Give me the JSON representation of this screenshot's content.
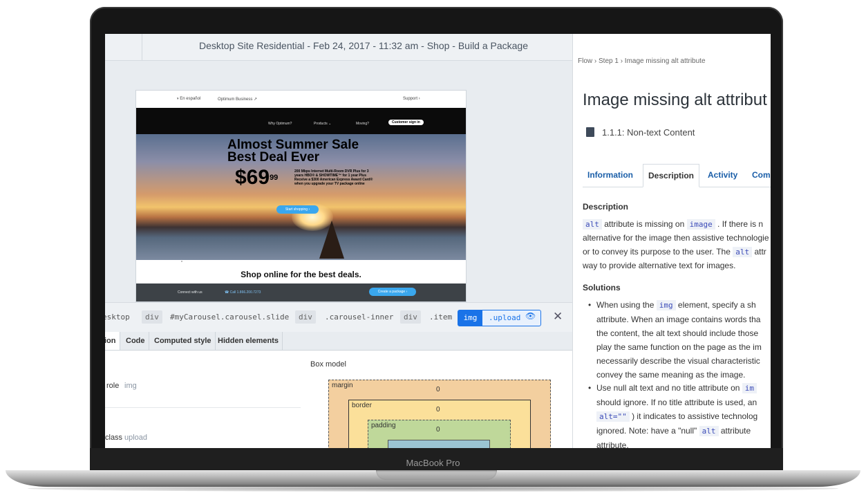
{
  "device": {
    "label": "MacBook Pro"
  },
  "header": {
    "title": "Desktop Site Residential - Feb 24, 2017 - 11:32 am - Shop - Build a Package"
  },
  "site": {
    "util_lang": "◑ En español",
    "util_business": "Optimum Business ↗",
    "util_support": "Support  ›",
    "nav_why": "Why Optimum?",
    "nav_products": "Products  ⌄",
    "nav_moving": "Moving?",
    "nav_signin": "Customer sign in",
    "hero_line1": "Almost Summer Sale",
    "hero_line2": "Best Deal Ever",
    "hero_price": "$69",
    "hero_price_cents": "99",
    "hero_promo": "200 Mbps Internet Multi-Room DVR Plus for 3 years HBO® & SHOWTIME™ for 1 year Plus Receive a $300 American Express Award Card® when you upgrade your TV package online",
    "hero_button": "Start shopping  ›",
    "shop_heading": "Shop online for the best deals.",
    "footer_connect": "Connect with us",
    "footer_call": "☎  Call 1.866.200.7273",
    "footer_cta": "Create a package  ›"
  },
  "crumbs": {
    "desktop": "esktop",
    "div1": "div",
    "carousel": "#myCarousel.carousel.slide",
    "div2": "div",
    "inner": ".carousel-inner",
    "div3": "div",
    "item": ".item",
    "selected_tag": "img",
    "selected_class": ".upload",
    "eye": "👁",
    "close": "✕"
  },
  "tabs": {
    "t1": "ion",
    "t2": "Code",
    "t3": "Computed style",
    "t4": "Hidden elements"
  },
  "props": {
    "role_label": "role",
    "role_value": "img",
    "class_label": "class",
    "class_value": "upload"
  },
  "box_model": {
    "title": "Box model",
    "margin_label": "margin",
    "margin_value": "0",
    "border_label": "border",
    "border_value": "0",
    "padding_label": "padding",
    "padding_value": "0"
  },
  "issue": {
    "breadcrumb": "Flow  ›  Step 1  ›  Image missing alt attribute",
    "title": "Image missing alt attribut",
    "criterion": "1.1.1: Non-text Content",
    "tabs": [
      "Information",
      "Description",
      "Activity",
      "Comm"
    ],
    "desc_heading": "Description",
    "desc_p1_code1": "alt",
    "desc_p1_text1": " attribute is missing on ",
    "desc_p1_code2": "image",
    "desc_p1_text2": " . If there is n",
    "desc_p2": "alternative for the image then assistive technologie",
    "desc_p3_text1": "or to convey its purpose to the user. The ",
    "desc_p3_code": "alt",
    "desc_p3_text2": " attr",
    "desc_p4": "way to provide alternative text for images.",
    "sol_heading": "Solutions",
    "b1_l1_text1": "When using the ",
    "b1_l1_code": "img",
    "b1_l1_text2": " element, specify a sh",
    "b1_l2": "attribute. When an image contains words tha",
    "b1_l3": "the content, the alt text should include those",
    "b1_l4": "play the same function on the page as the im",
    "b1_l5": "necessarily describe the visual characteristic",
    "b1_l6": "convey the same meaning as the image.",
    "b2_l1_text1": "Use null alt text and no title attribute on ",
    "b2_l1_code": "im",
    "b2_l2": "should ignore. If no title attribute is used, an",
    "b2_l3_code": "alt=\"\"",
    "b2_l3_text": " ) it indicates to assistive technolog",
    "b2_l4_text1": "ignored. Note: have a \"null\" ",
    "b2_l4_code": "alt",
    "b2_l4_text2": " attribute",
    "b2_l5": "attribute."
  }
}
